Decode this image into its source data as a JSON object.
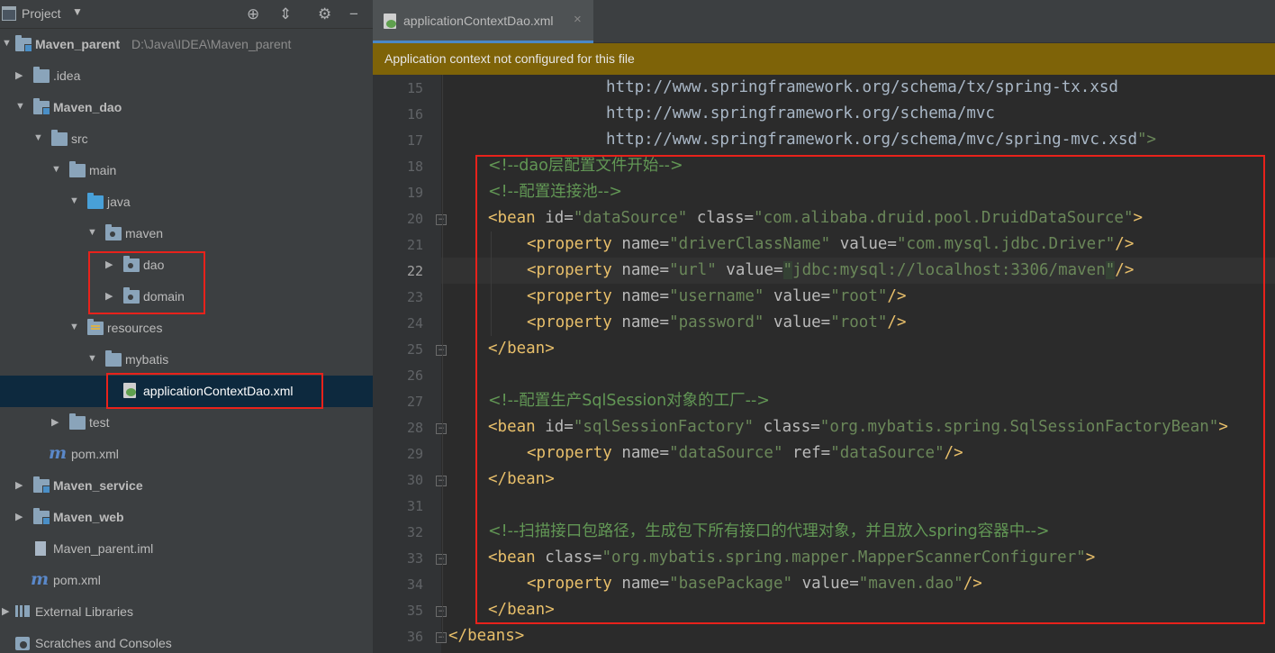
{
  "project_panel": {
    "title": "Project",
    "toolbar": {
      "locate_icon": "target-icon",
      "collapse_icon": "collapse-icon",
      "settings_icon": "gear-icon",
      "hide_icon": "minus-icon"
    },
    "tree": [
      {
        "label": "Maven_parent",
        "path": "D:\\Java\\IDEA\\Maven_parent",
        "bold": true
      },
      {
        "label": ".idea"
      },
      {
        "label": "Maven_dao",
        "bold": true
      },
      {
        "label": "src"
      },
      {
        "label": "main"
      },
      {
        "label": "java"
      },
      {
        "label": "maven"
      },
      {
        "label": "dao"
      },
      {
        "label": "domain"
      },
      {
        "label": "resources"
      },
      {
        "label": "mybatis"
      },
      {
        "label": "applicationContextDao.xml",
        "selected": true
      },
      {
        "label": "test"
      },
      {
        "label": "pom.xml"
      },
      {
        "label": "Maven_service",
        "bold": true
      },
      {
        "label": "Maven_web",
        "bold": true
      },
      {
        "label": "Maven_parent.iml"
      },
      {
        "label": "pom.xml"
      },
      {
        "label": "External Libraries"
      },
      {
        "label": "Scratches and Consoles"
      }
    ]
  },
  "editor": {
    "tab": {
      "label": "applicationContextDao.xml",
      "close": "×"
    },
    "notification": "Application context not configured for this file",
    "current_line": 22,
    "lines": [
      {
        "n": "15"
      },
      {
        "n": "16"
      },
      {
        "n": "17"
      },
      {
        "n": "18"
      },
      {
        "n": "19"
      },
      {
        "n": "20"
      },
      {
        "n": "21"
      },
      {
        "n": "22"
      },
      {
        "n": "23"
      },
      {
        "n": "24"
      },
      {
        "n": "25"
      },
      {
        "n": "26"
      },
      {
        "n": "27"
      },
      {
        "n": "28"
      },
      {
        "n": "29"
      },
      {
        "n": "30"
      },
      {
        "n": "31"
      },
      {
        "n": "32"
      },
      {
        "n": "33"
      },
      {
        "n": "34"
      },
      {
        "n": "35"
      },
      {
        "n": "36"
      }
    ],
    "code": {
      "l15": "http://www.springframework.org/schema/tx/spring-tx.xsd",
      "l16": "http://www.springframework.org/schema/mvc",
      "l17a": "http://www.springframework.org/schema/mvc/spring-mvc.xsd",
      "l17b": "\">",
      "l18": "<!--dao层配置文件开始-->",
      "l19": "<!--配置连接池-->",
      "l20": {
        "open": "<bean",
        "a1": "id=",
        "v1": "\"dataSource\"",
        "a2": "class=",
        "v2": "\"com.alibaba.druid.pool.DruidDataSource\"",
        "close": ">"
      },
      "l21": {
        "open": "<property",
        "a1": "name=",
        "v1": "\"driverClassName\"",
        "a2": "value=",
        "v2": "\"com.mysql.jdbc.Driver\"",
        "close": "/>"
      },
      "l22": {
        "open": "<property",
        "a1": "name=",
        "v1": "\"url\"",
        "a2": "value=",
        "q1": "\"",
        "v2": "jdbc:mysql://localhost:3306/maven",
        "q2": "\"",
        "close": "/>"
      },
      "l23": {
        "open": "<property",
        "a1": "name=",
        "v1": "\"username\"",
        "a2": "value=",
        "v2": "\"root\"",
        "close": "/>"
      },
      "l24": {
        "open": "<property",
        "a1": "name=",
        "v1": "\"password\"",
        "a2": "value=",
        "v2": "\"root\"",
        "close": "/>"
      },
      "l25": "</bean>",
      "l27": "<!--配置生产SqlSession对象的工厂-->",
      "l28": {
        "open": "<bean",
        "a1": "id=",
        "v1": "\"sqlSessionFactory\"",
        "a2": "class=",
        "v2": "\"org.mybatis.spring.SqlSessionFactoryBean\"",
        "close": ">"
      },
      "l29": {
        "open": "<property",
        "a1": "name=",
        "v1": "\"dataSource\"",
        "a2": "ref=",
        "v2": "\"dataSource\"",
        "close": "/>"
      },
      "l30": "</bean>",
      "l32": "<!--扫描接口包路径，生成包下所有接口的代理对象，并且放入spring容器中-->",
      "l33": {
        "open": "<bean",
        "a1": "class=",
        "v1": "\"org.mybatis.spring.mapper.MapperScannerConfigurer\"",
        "close": ">"
      },
      "l34": {
        "open": "<property",
        "a1": "name=",
        "v1": "\"basePackage\"",
        "a2": "value=",
        "v2": "\"maven.dao\"",
        "close": "/>"
      },
      "l35": "</bean>",
      "l36": "</beans>"
    }
  },
  "colors": {
    "selection": "#0d293e",
    "highlight_box": "#e8221b",
    "notification_bg": "#7e6308",
    "tag": "#e8bf6a",
    "attr_value": "#6a8759",
    "comment": "#629755"
  }
}
